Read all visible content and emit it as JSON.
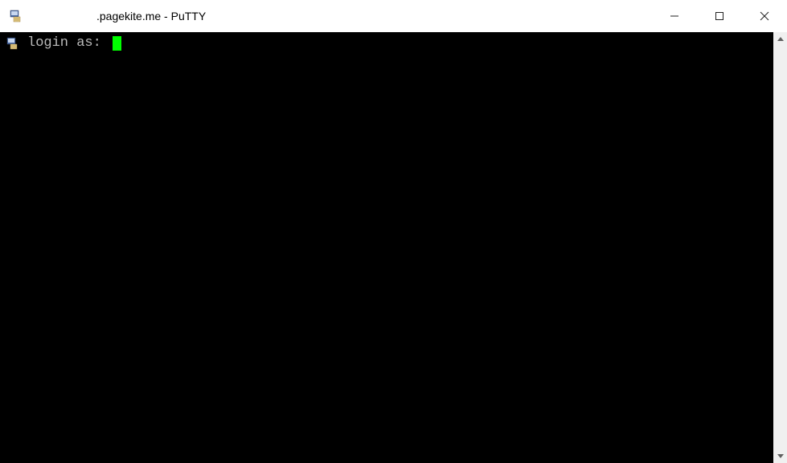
{
  "window": {
    "title": ".pagekite.me - PuTTY"
  },
  "terminal": {
    "prompt": "login as: "
  },
  "icons": {
    "app": "putty-icon",
    "prompt": "putty-icon"
  }
}
